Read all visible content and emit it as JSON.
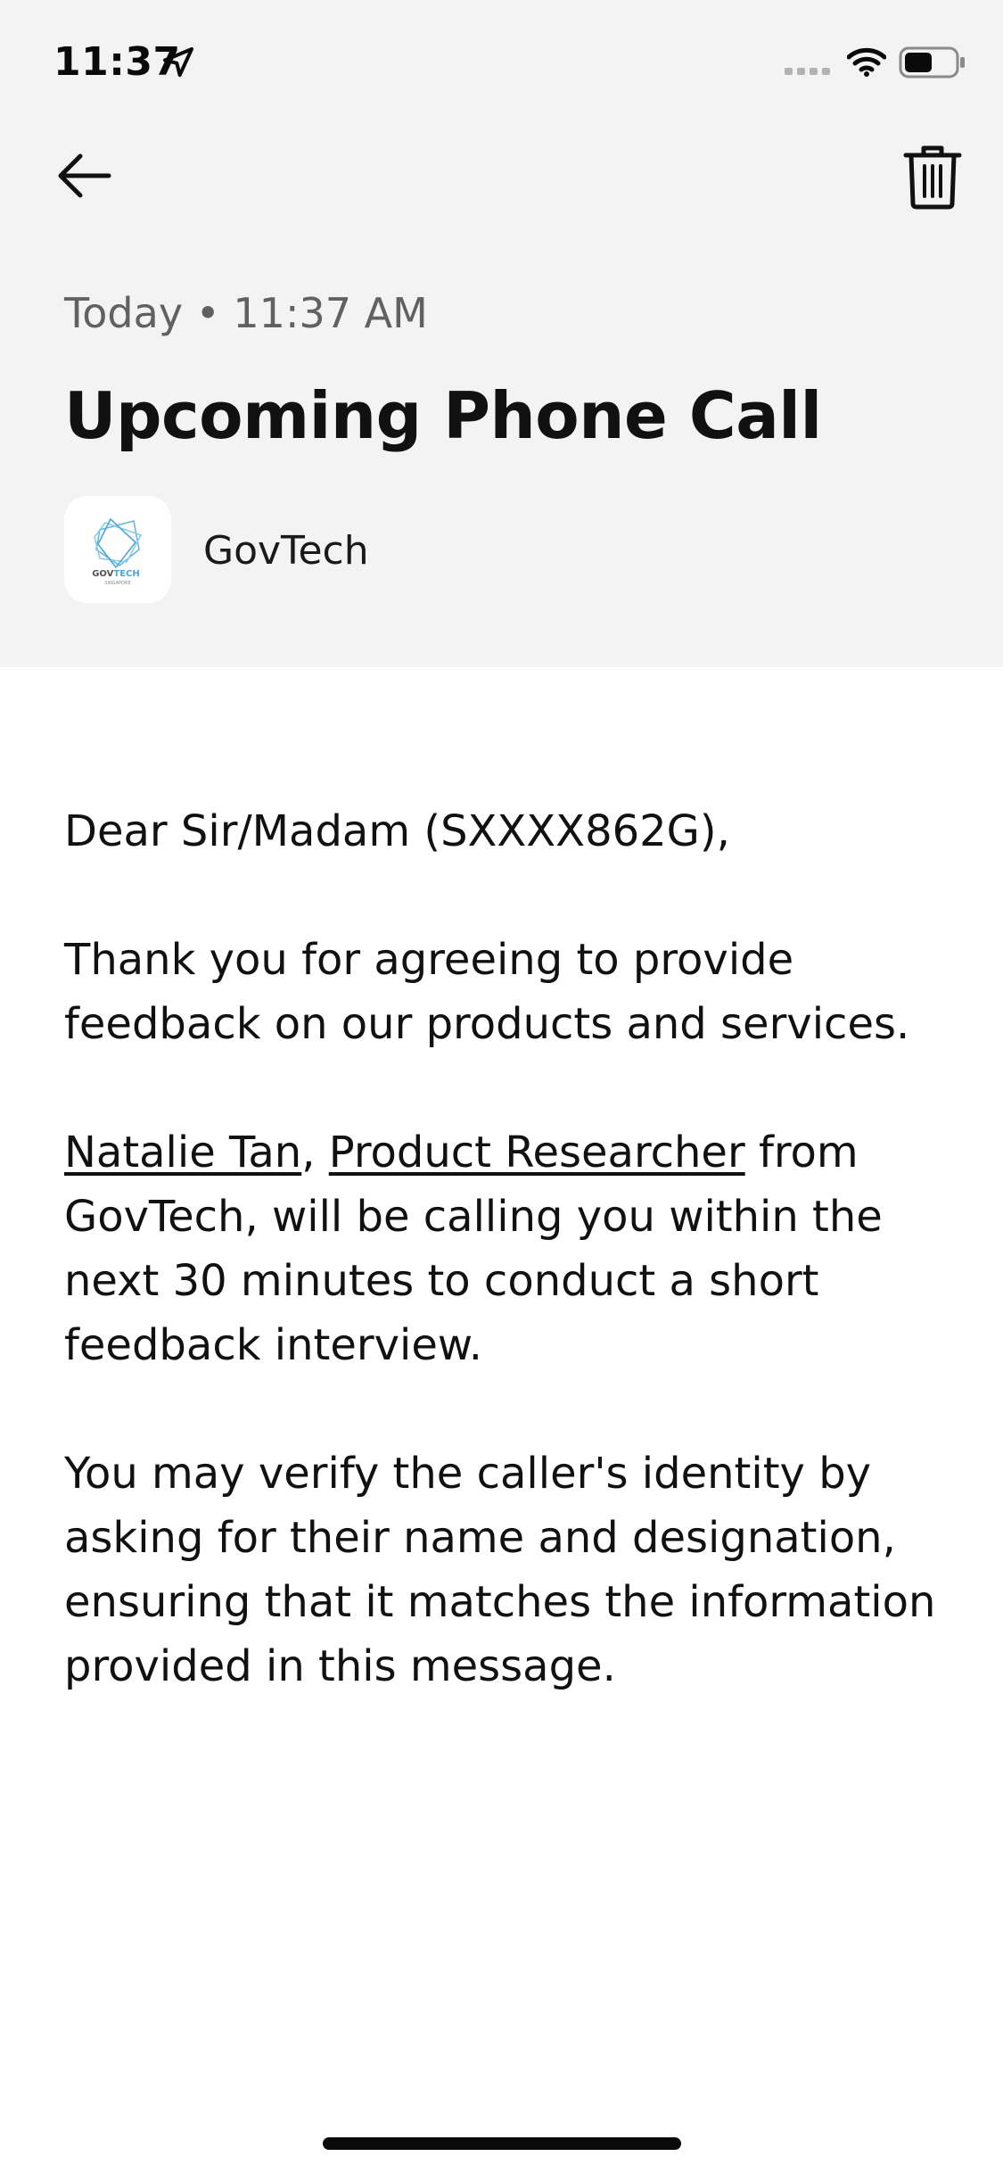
{
  "status_bar": {
    "time": "11:37",
    "icons": [
      "location-arrow-icon",
      "signal-icon",
      "wifi-icon",
      "battery-icon"
    ]
  },
  "nav": {
    "back_icon": "arrow-left-icon",
    "delete_icon": "trash-icon"
  },
  "message": {
    "timestamp": "Today • 11:37 AM",
    "title": "Upcoming Phone Call",
    "sender": {
      "name": "GovTech",
      "logo_text": "GOVTECH",
      "logo_subtext": "SINGAPORE"
    },
    "greeting": "Dear Sir/Madam (SXXXX862G),",
    "paragraph1": "Thank you for agreeing to provide feedback on our products and services.",
    "caller_name": "Natalie Tan",
    "separator": ", ",
    "caller_role": "Product Researcher",
    "paragraph3_rest": " from GovTech, will be calling you within the next 30 minutes to conduct a short feedback interview.",
    "paragraph4": "You may verify the caller's identity by asking for their name and designation, ensuring that it matches the information provided in this message."
  },
  "colors": {
    "header_bg": "#f3f3f3",
    "body_bg": "#ffffff",
    "text": "#111111",
    "muted": "#616161",
    "logo_accent": "#4aa8d8"
  }
}
